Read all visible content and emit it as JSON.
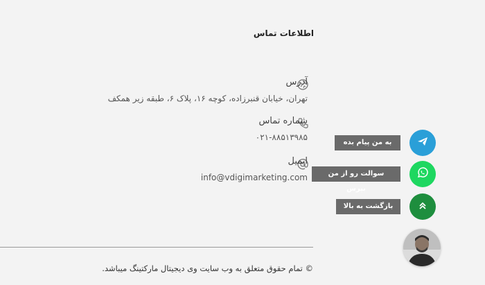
{
  "contact": {
    "title": "اطلاعات تماس",
    "address": {
      "label": "آدرس",
      "value": "تهران، خیابان قنبرزاده، کوچه ۱۶، پلاک ۶، طبقه زیر همکف",
      "icon": "globe-icon"
    },
    "phone": {
      "label": "شماره تماس",
      "value": "۰۲۱-۸۸۵۱۳۹۸۵",
      "icon": "phone-icon"
    },
    "email": {
      "label": "ایمیل",
      "value": "info@vdigimarketing.com",
      "icon": "at-icon"
    }
  },
  "footer": {
    "copyright": "© تمام حقوق متعلق به وب سایت وی دیجیتال مارکتینگ میباشد."
  },
  "floating": {
    "message": {
      "label": "به من پیام بده",
      "color": "#2a9fd8",
      "icon": "telegram-icon"
    },
    "question": {
      "label": "سوالت رو از من بپرس",
      "color": "#1ed760",
      "icon": "whatsapp-icon"
    },
    "top": {
      "label": "بازگشت به بالا",
      "color": "#1e8e3e",
      "icon": "chevron-up-double-icon"
    },
    "avatar": {
      "icon": "avatar"
    }
  }
}
